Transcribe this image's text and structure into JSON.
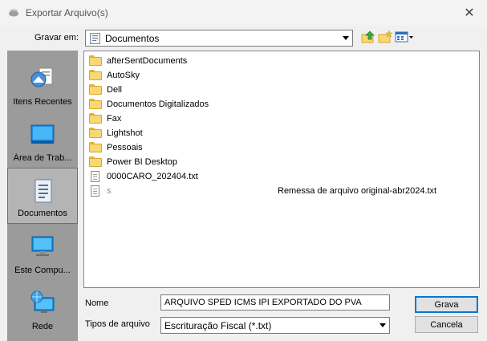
{
  "window": {
    "title": "Exportar Arquivo(s)",
    "close_glyph": "✕"
  },
  "save_in": {
    "label": "Gravar em:",
    "value": "Documentos"
  },
  "places": [
    {
      "label": "Itens Recentes",
      "icon": "recent-items-icon"
    },
    {
      "label": "Área de Trab...",
      "icon": "desktop-icon"
    },
    {
      "label": "Documentos",
      "icon": "documents-icon",
      "selected": true
    },
    {
      "label": "Este Compu...",
      "icon": "this-computer-icon"
    },
    {
      "label": "Rede",
      "icon": "network-icon"
    }
  ],
  "files": [
    {
      "name": "afterSentDocuments",
      "type": "folder"
    },
    {
      "name": "AutoSky",
      "type": "folder"
    },
    {
      "name": "Dell",
      "type": "folder"
    },
    {
      "name": "Documentos Digitalizados",
      "type": "folder"
    },
    {
      "name": "Fax",
      "type": "folder"
    },
    {
      "name": "Lightshot",
      "type": "folder"
    },
    {
      "name": "Pessoais",
      "type": "folder"
    },
    {
      "name": "Power BI Desktop",
      "type": "folder"
    },
    {
      "name": "0000CARO_202404.txt",
      "type": "txt"
    },
    {
      "name": "Remessa de arquivo original-abr2024.txt",
      "prefix": "S",
      "type": "txt"
    }
  ],
  "name_field": {
    "label": "Nome",
    "value": "ARQUIVO SPED ICMS IPI EXPORTADO DO PVA"
  },
  "type_field": {
    "label": "Tipos de arquivo",
    "value": "Escrituração Fiscal (*.txt)"
  },
  "buttons": {
    "save": "Grava",
    "cancel": "Cancela"
  }
}
